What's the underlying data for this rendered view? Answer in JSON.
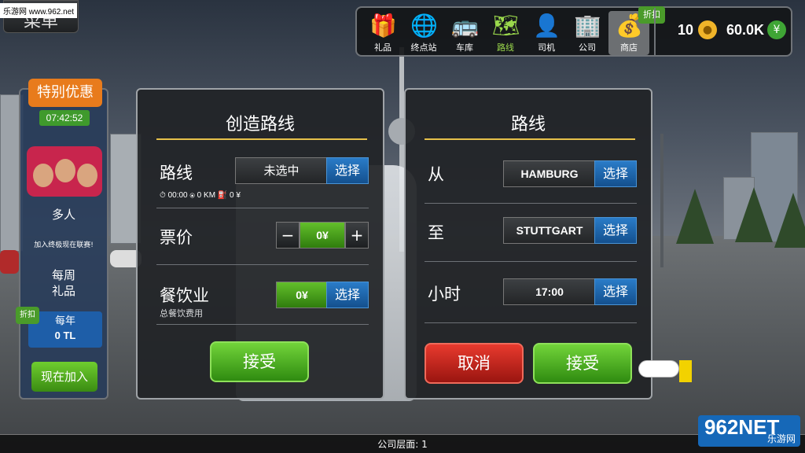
{
  "watermark": {
    "site": "乐游网 www.962.net",
    "logo_big": "962NET",
    "logo_small": "乐游网"
  },
  "back_button": "菜单",
  "nav": [
    {
      "label": "礼品",
      "icon": "gift-icon",
      "glyph": "🎁"
    },
    {
      "label": "终点站",
      "icon": "terminal-icon",
      "glyph": "🌐"
    },
    {
      "label": "车库",
      "icon": "bus-icon",
      "glyph": "🚌"
    },
    {
      "label": "路线",
      "icon": "map-icon",
      "glyph": "🗺"
    },
    {
      "label": "司机",
      "icon": "driver-icon",
      "glyph": "👤"
    },
    {
      "label": "公司",
      "icon": "company-icon",
      "glyph": "🏢"
    }
  ],
  "shop": {
    "label": "商店",
    "icon": "coins-icon",
    "glyph": "💰",
    "discount": "折扣"
  },
  "currency": {
    "coins": "10",
    "coin_glyph": "●",
    "money": "60.0K",
    "money_glyph": "¥"
  },
  "promo": {
    "title": "特别优惠",
    "timer": "07:42:52",
    "multiplayer": "多人",
    "multiplayer_sub": "加入终极现在联赛!",
    "weekly_line1": "每周",
    "weekly_line2": "礼品",
    "discount": "折扣",
    "yearly_line1": "每年",
    "yearly_line2": "0 TL",
    "join": "现在加入"
  },
  "create_route": {
    "title": "创造路线",
    "route_label": "路线",
    "route_value": "未选中",
    "select": "选择",
    "stats": "⏱ 00:00  ⦿ 0 KM  ⛽ 0 ¥",
    "ticket_label": "票价",
    "ticket_value": "0¥",
    "minus": "−",
    "plus": "+",
    "catering_label": "餐饮业",
    "catering_sub": "总餐饮费用",
    "catering_value": "0¥",
    "accept": "接受"
  },
  "route": {
    "title": "路线",
    "from_label": "从",
    "from_value": "HAMBURG",
    "to_label": "至",
    "to_value": "STUTTGART",
    "hour_label": "小时",
    "hour_value": "17:00",
    "select": "选择",
    "cancel": "取消",
    "accept": "接受"
  },
  "footer": {
    "floor": "公司层面: 1"
  },
  "colors": {
    "accent_green": "#3f9a2c",
    "accent_blue": "#1e5ea8",
    "accent_orange": "#e87b1c",
    "title_line": "#e6c14a"
  }
}
